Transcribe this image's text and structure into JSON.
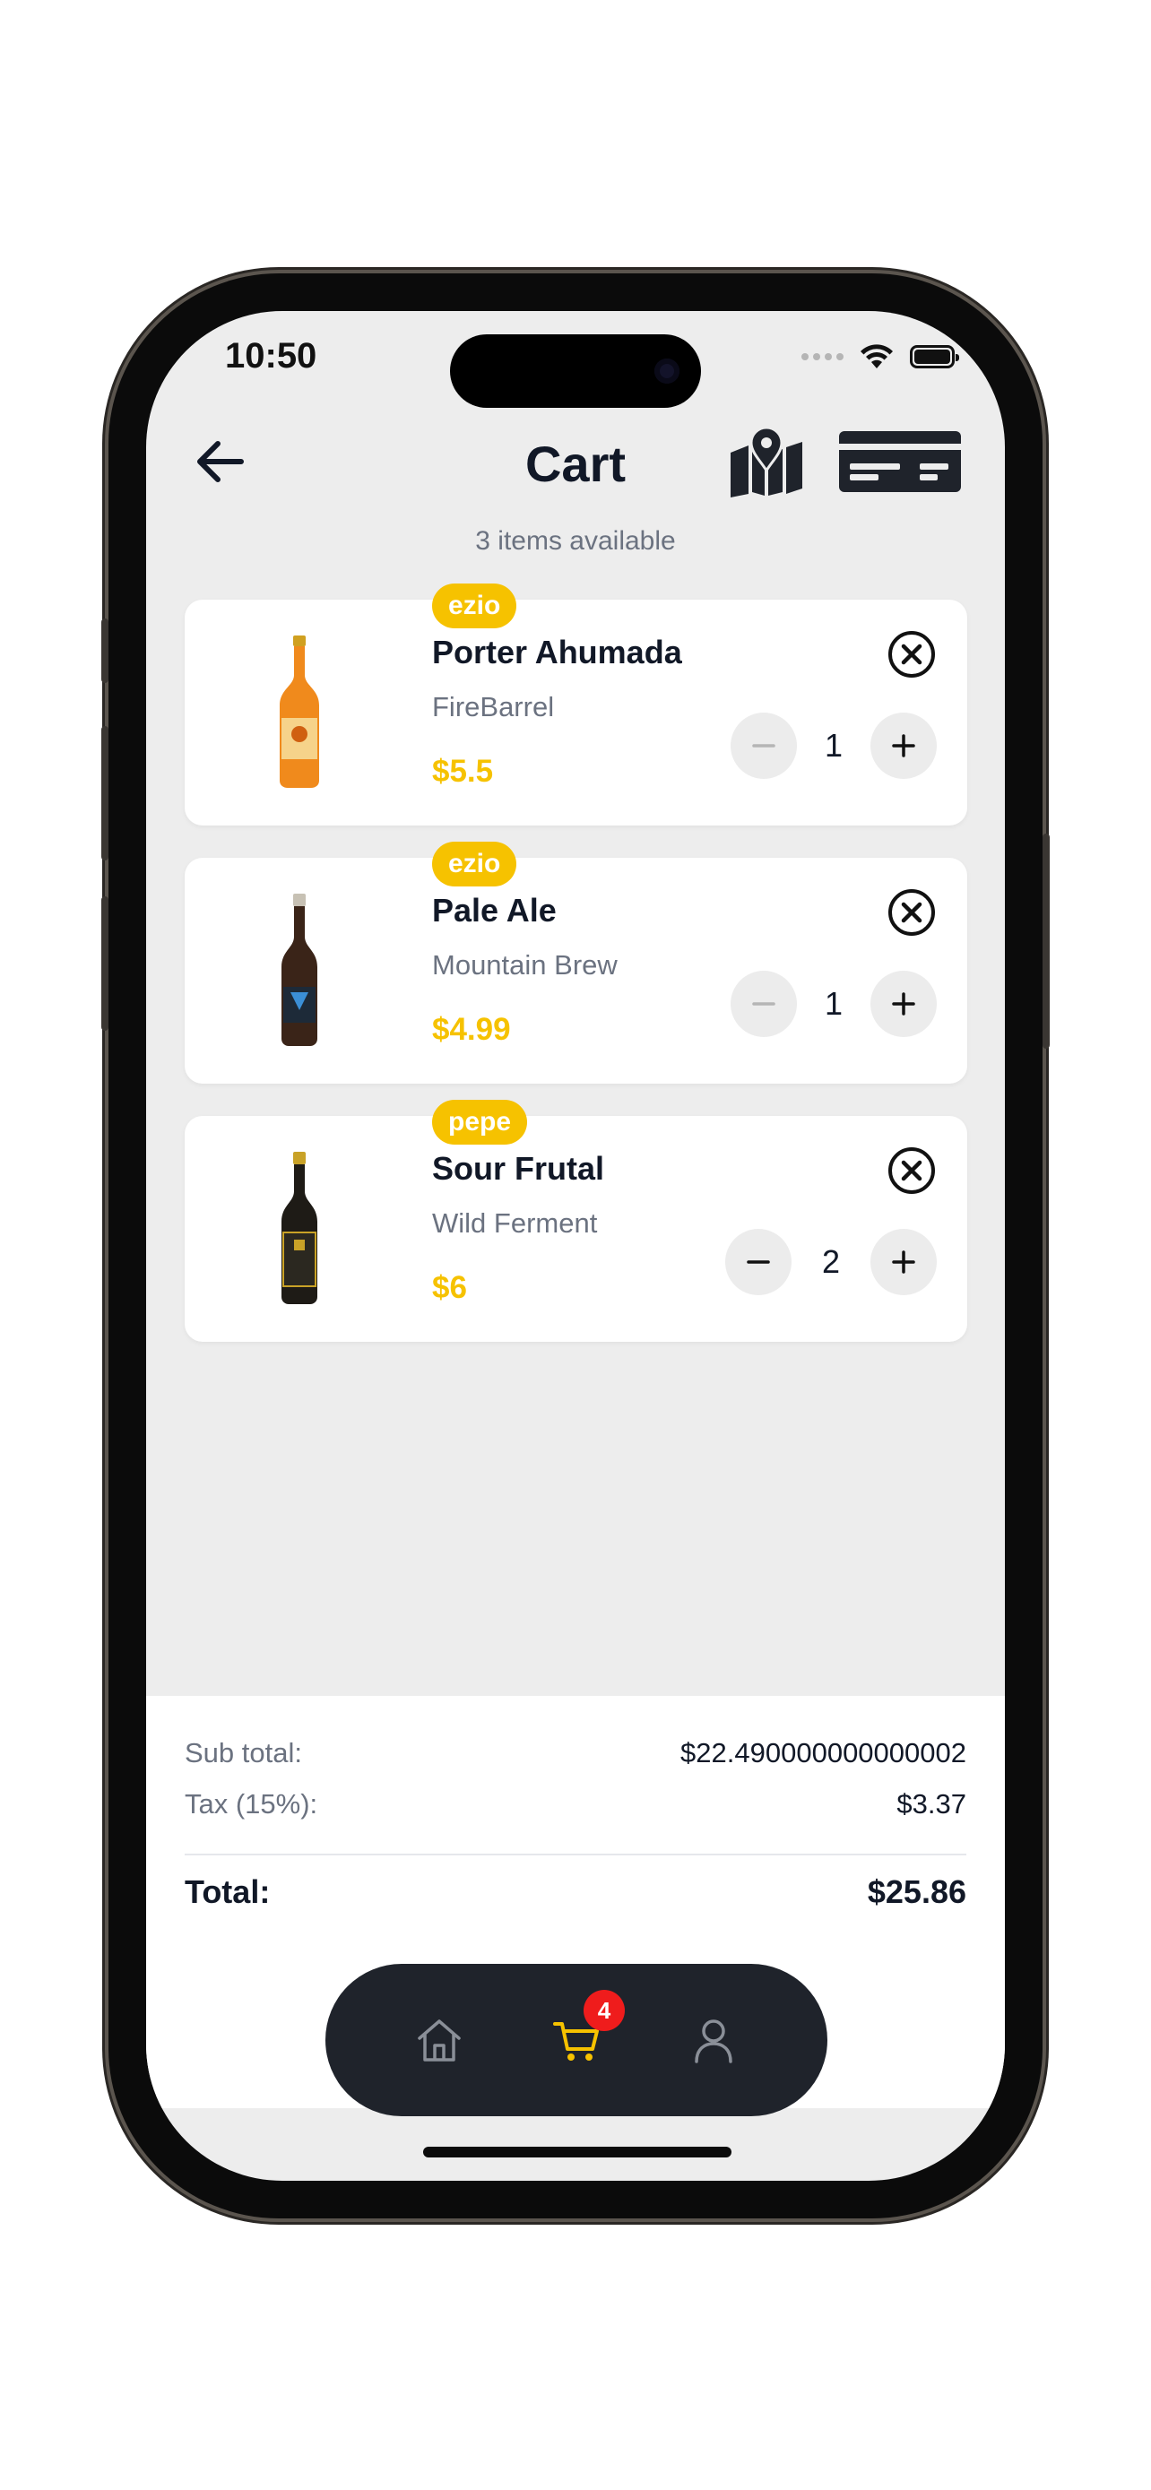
{
  "status_bar": {
    "time": "10:50"
  },
  "header": {
    "title": "Cart",
    "subtitle": "3 items available",
    "icons": {
      "back": "arrow-left-icon",
      "map": "map-pin-icon",
      "card": "credit-card-icon"
    }
  },
  "cart": {
    "items": [
      {
        "tag": "ezio",
        "name": "Porter Ahumada",
        "brand": "FireBarrel",
        "price": "$5.5",
        "quantity": "1",
        "bottle_color": "#f08a1c",
        "minus_enabled": false
      },
      {
        "tag": "ezio",
        "name": "Pale Ale",
        "brand": "Mountain Brew",
        "price": "$4.99",
        "quantity": "1",
        "bottle_color": "#3a2418",
        "minus_enabled": false
      },
      {
        "tag": "pepe",
        "name": "Sour Frutal",
        "brand": "Wild Ferment",
        "price": "$6",
        "quantity": "2",
        "bottle_color": "#1e1b16",
        "minus_enabled": true
      }
    ]
  },
  "summary": {
    "subtotal_label": "Sub total:",
    "subtotal_value": "$22.490000000000002",
    "tax_label": "Tax (15%):",
    "tax_value": "$3.37",
    "total_label": "Total:",
    "total_value": "$25.86"
  },
  "tabbar": {
    "items": [
      {
        "name": "home",
        "icon": "home-icon",
        "active": false
      },
      {
        "name": "cart",
        "icon": "cart-icon",
        "active": true,
        "badge": "4"
      },
      {
        "name": "profile",
        "icon": "user-icon",
        "active": false
      }
    ]
  },
  "colors": {
    "accent": "#f6c200",
    "badge": "#ef1c1c",
    "tabbar_bg": "#1f232b",
    "screen_bg": "#ededed"
  }
}
